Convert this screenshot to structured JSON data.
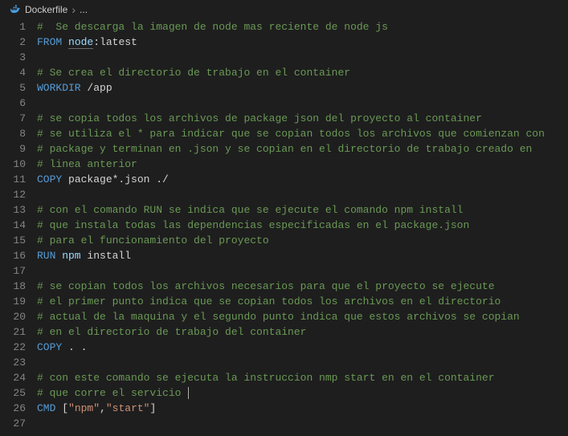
{
  "breadcrumb": {
    "icon": "docker-icon",
    "file": "Dockerfile",
    "more": "..."
  },
  "lines": [
    {
      "n": 1,
      "t": [
        {
          "c": "tok-comment",
          "v": "#  Se descarga la imagen de node mas reciente de node js"
        }
      ]
    },
    {
      "n": 2,
      "t": [
        {
          "c": "tok-keyword",
          "v": "FROM"
        },
        {
          "c": "tok-plain",
          "v": " "
        },
        {
          "c": "tok-ident underline",
          "v": "node"
        },
        {
          "c": "tok-plain",
          "v": ":latest"
        }
      ]
    },
    {
      "n": 3,
      "t": []
    },
    {
      "n": 4,
      "t": [
        {
          "c": "tok-comment",
          "v": "# Se crea el directorio de trabajo en el container"
        }
      ]
    },
    {
      "n": 5,
      "t": [
        {
          "c": "tok-keyword",
          "v": "WORKDIR"
        },
        {
          "c": "tok-plain",
          "v": " /app"
        }
      ]
    },
    {
      "n": 6,
      "t": []
    },
    {
      "n": 7,
      "t": [
        {
          "c": "tok-comment",
          "v": "# se copia todos los archivos de package json del proyecto al container"
        }
      ]
    },
    {
      "n": 8,
      "t": [
        {
          "c": "tok-comment",
          "v": "# se utiliza el * para indicar que se copian todos los archivos que comienzan con"
        }
      ]
    },
    {
      "n": 9,
      "t": [
        {
          "c": "tok-comment",
          "v": "# package y terminan en .json y se copian en el directorio de trabajo creado en"
        }
      ]
    },
    {
      "n": 10,
      "t": [
        {
          "c": "tok-comment",
          "v": "# linea anterior"
        }
      ]
    },
    {
      "n": 11,
      "t": [
        {
          "c": "tok-keyword",
          "v": "COPY"
        },
        {
          "c": "tok-plain",
          "v": " package*.json ./"
        }
      ]
    },
    {
      "n": 12,
      "t": []
    },
    {
      "n": 13,
      "t": [
        {
          "c": "tok-comment",
          "v": "# con el comando RUN se indica que se ejecute el comando npm install"
        }
      ]
    },
    {
      "n": 14,
      "t": [
        {
          "c": "tok-comment",
          "v": "# que instala todas las dependencias especificadas en el package.json"
        }
      ]
    },
    {
      "n": 15,
      "t": [
        {
          "c": "tok-comment",
          "v": "# para el funcionamiento del proyecto"
        }
      ]
    },
    {
      "n": 16,
      "t": [
        {
          "c": "tok-keyword",
          "v": "RUN"
        },
        {
          "c": "tok-ident",
          "v": " npm"
        },
        {
          "c": "tok-plain",
          "v": " install"
        }
      ]
    },
    {
      "n": 17,
      "t": []
    },
    {
      "n": 18,
      "t": [
        {
          "c": "tok-comment",
          "v": "# se copian todos los archivos necesarios para que el proyecto se ejecute"
        }
      ]
    },
    {
      "n": 19,
      "t": [
        {
          "c": "tok-comment",
          "v": "# el primer punto indica que se copian todos los archivos en el directorio"
        }
      ]
    },
    {
      "n": 20,
      "t": [
        {
          "c": "tok-comment",
          "v": "# actual de la maquina y el segundo punto indica que estos archivos se copian"
        }
      ]
    },
    {
      "n": 21,
      "t": [
        {
          "c": "tok-comment",
          "v": "# en el directorio de trabajo del container"
        }
      ]
    },
    {
      "n": 22,
      "t": [
        {
          "c": "tok-keyword",
          "v": "COPY"
        },
        {
          "c": "tok-plain",
          "v": " . ."
        }
      ]
    },
    {
      "n": 23,
      "t": []
    },
    {
      "n": 24,
      "t": [
        {
          "c": "tok-comment",
          "v": "# con este comando se ejecuta la instruccion nmp start en en el container"
        }
      ]
    },
    {
      "n": 25,
      "t": [
        {
          "c": "tok-comment",
          "v": "# que corre el servicio "
        }
      ],
      "cursor": true
    },
    {
      "n": 26,
      "t": [
        {
          "c": "tok-keyword",
          "v": "CMD"
        },
        {
          "c": "tok-plain",
          "v": " "
        },
        {
          "c": "tok-punct",
          "v": "["
        },
        {
          "c": "tok-string",
          "v": "\"npm\""
        },
        {
          "c": "tok-punct",
          "v": ","
        },
        {
          "c": "tok-string",
          "v": "\"start\""
        },
        {
          "c": "tok-punct",
          "v": "]"
        }
      ]
    },
    {
      "n": 27,
      "t": []
    }
  ]
}
